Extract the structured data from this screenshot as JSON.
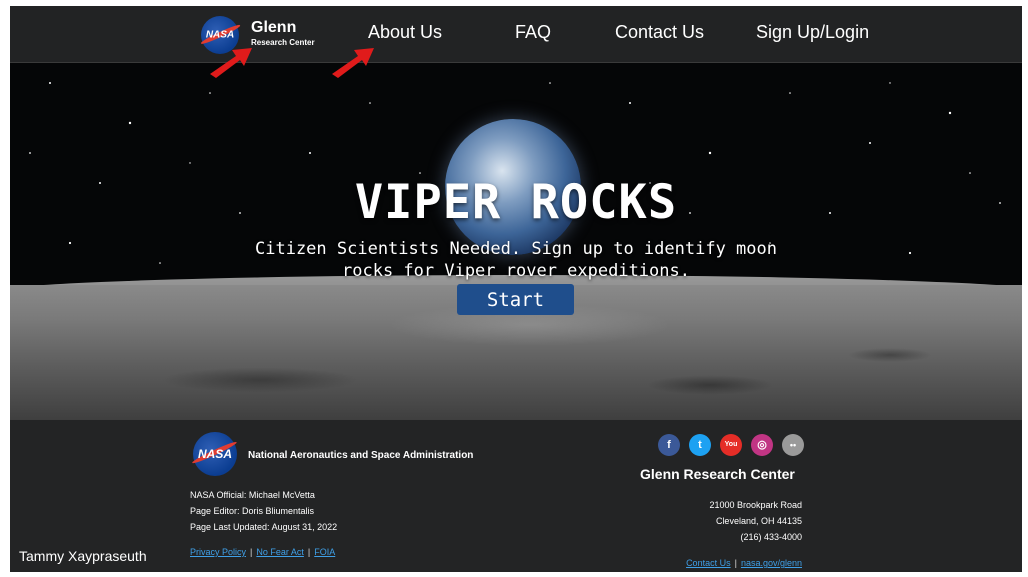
{
  "nav": {
    "logo_text": "NASA",
    "brand_title": "Glenn",
    "brand_subtitle": "Research Center",
    "links": [
      "About Us",
      "FAQ",
      "Contact Us",
      "Sign Up/Login"
    ]
  },
  "hero": {
    "title": "VIPER ROCKS",
    "subtitle_line1": "Citizen Scientists Needed. Sign up to identify moon",
    "subtitle_line2": "rocks for Viper rover expeditions.",
    "start_label": "Start"
  },
  "footer": {
    "logo_text": "NASA",
    "agency": "National Aeronautics and Space Administration",
    "official": "NASA Official: Michael McVetta",
    "editor": "Page Editor: Doris Bliumentalis",
    "updated": "Page Last Updated: August 31, 2022",
    "links": [
      "Privacy Policy",
      "No Fear Act",
      "FOIA"
    ],
    "social": [
      {
        "name": "facebook",
        "glyph": "f",
        "color": "#3b5998"
      },
      {
        "name": "twitter",
        "glyph": "t",
        "color": "#1da1f2"
      },
      {
        "name": "youtube",
        "glyph": "You",
        "color": "#e52d27"
      },
      {
        "name": "instagram",
        "glyph": "◎",
        "color": "#c13584"
      },
      {
        "name": "flickr",
        "glyph": "••",
        "color": "#9a9a9a"
      }
    ],
    "center_name": "Glenn Research Center",
    "address1": "21000 Brookpark Road",
    "address2": "Cleveland, OH 44135",
    "phone": "(216) 433-4000",
    "right_links": [
      "Contact Us",
      "nasa.gov/glenn"
    ]
  },
  "author": "Tammy Xaypraseuth",
  "colors": {
    "background": "#232425",
    "button": "#1f4e8c",
    "link": "#3fa0e8",
    "annotation_arrow": "#e01b1b"
  }
}
